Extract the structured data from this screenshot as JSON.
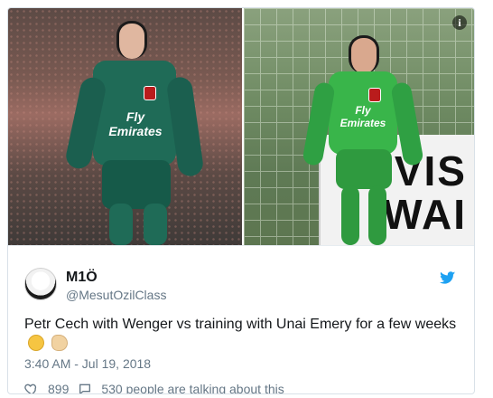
{
  "tweet": {
    "display_name": "M1Ö",
    "handle": "@MesutOzilClass",
    "text_main": "Petr Cech  with Wenger vs training with Unai Emery for a few weeks",
    "timestamp": "3:40 AM - Jul 19, 2018",
    "likes_count": "899",
    "conversation_text": "530 people are talking about this"
  },
  "media": {
    "left_shirt_sponsor": "Fly Emirates",
    "right_shirt_sponsor": "Fly Emirates",
    "sign_line1": "VIS",
    "sign_line2": "WAI",
    "info_symbol": "i"
  },
  "icons": {
    "info": "info-icon",
    "twitter": "twitter-bird-icon",
    "like": "heart-icon",
    "conversation": "chat-bubble-icon",
    "emoji1": "laughing-face-emoji",
    "emoji2": "flexed-bicep-emoji"
  },
  "colors": {
    "twitter_blue": "#1da1f2",
    "text": "#14171a",
    "muted": "#657786",
    "border": "#d9e1e8",
    "arsenal_red": "#b91c1c",
    "keeper_teal": "#1f6b57",
    "keeper_green": "#39b54a"
  }
}
